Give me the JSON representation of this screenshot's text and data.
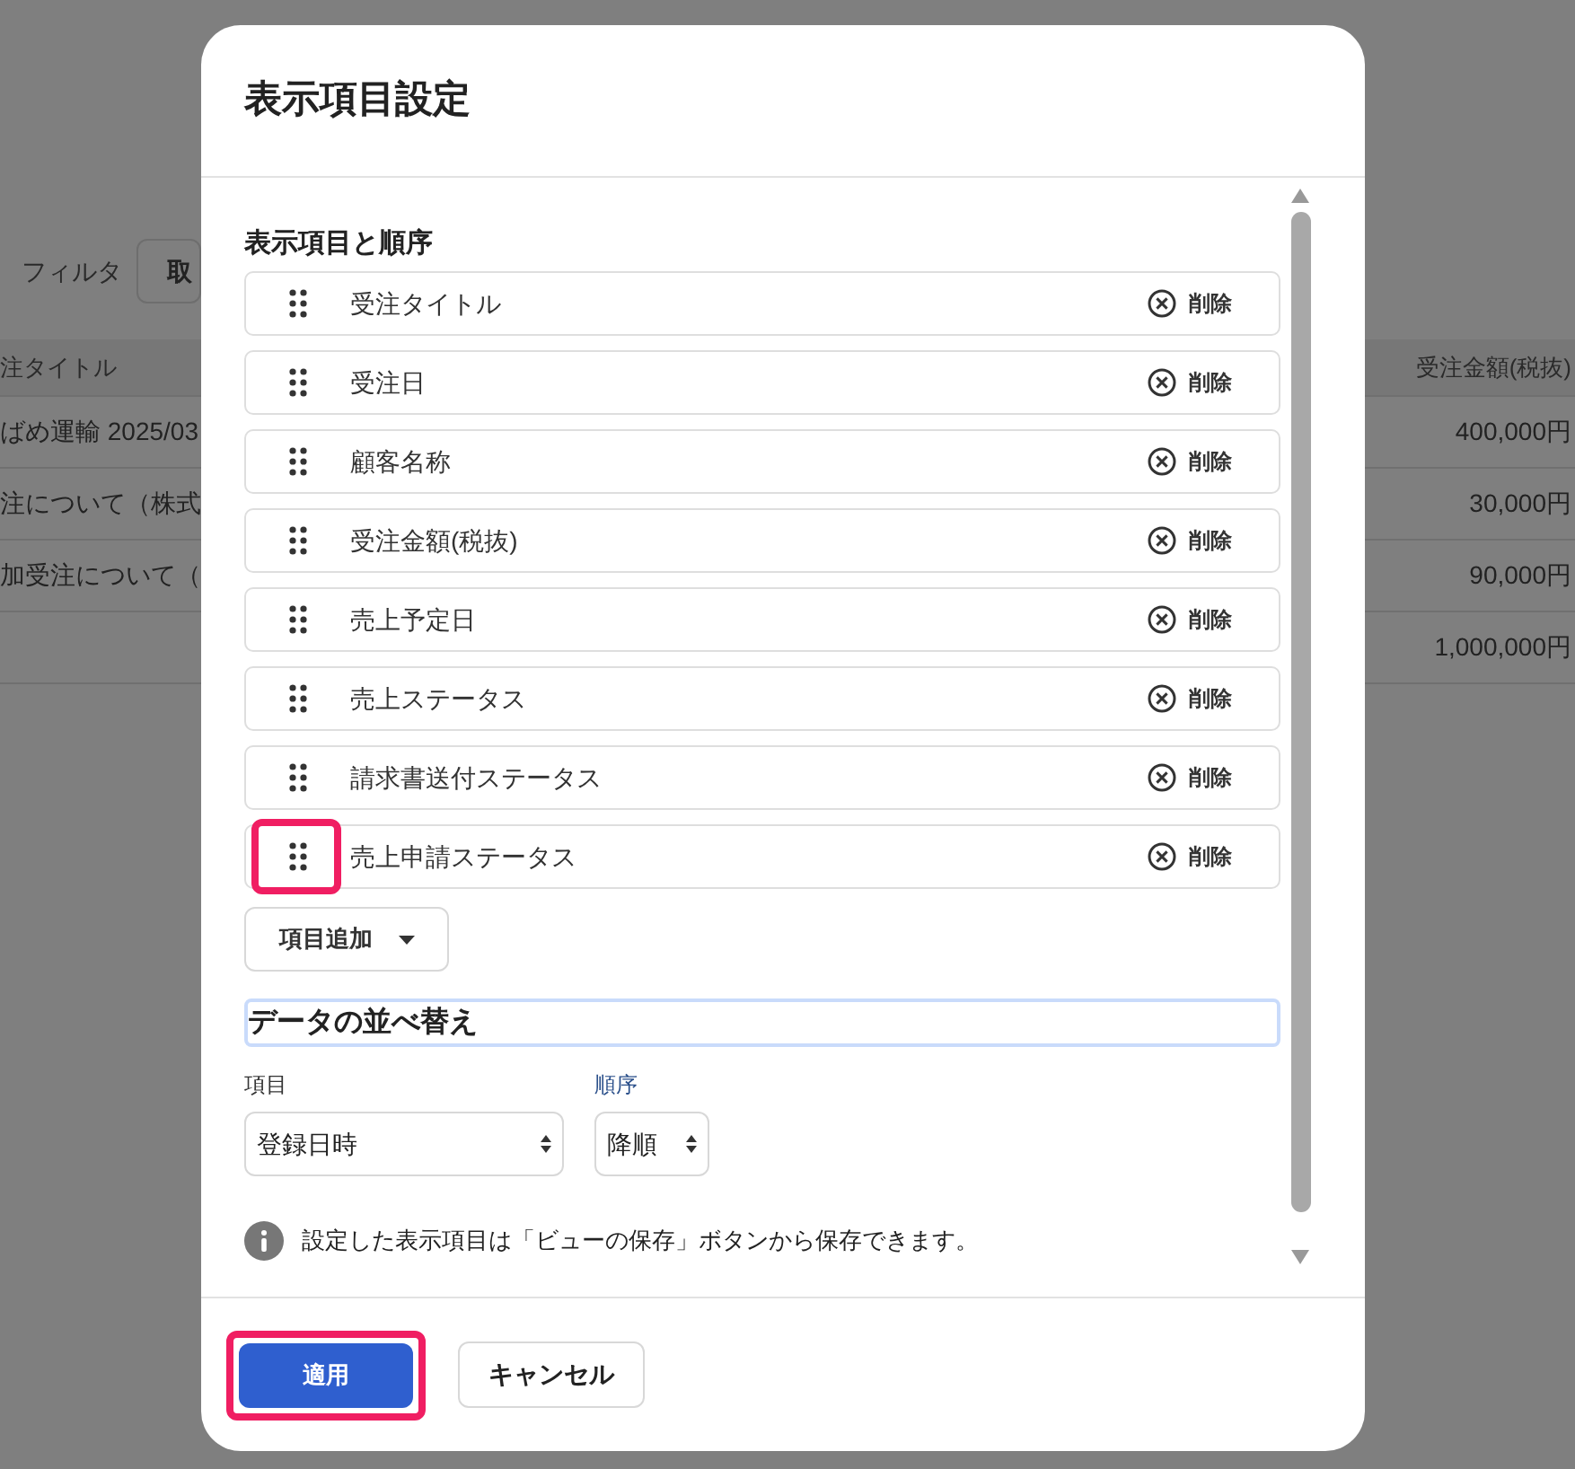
{
  "background": {
    "filter_label": "フィルタ",
    "cancel_button": "取",
    "columns": [
      "注タイトル",
      "受注金額(税抜)"
    ],
    "rows": [
      {
        "title": "ばめ運輸 2025/03",
        "amount": "400,000円"
      },
      {
        "title": "注について（株式",
        "amount": "30,000円"
      },
      {
        "title": "加受注について（",
        "amount": "90,000円"
      },
      {
        "amount": "1,000,000円"
      }
    ]
  },
  "dialog": {
    "title": "表示項目設定",
    "section_title": "表示項目と順序",
    "items": [
      {
        "label": "受注タイトル",
        "remove_label": "削除",
        "highlighted": false
      },
      {
        "label": "受注日",
        "remove_label": "削除",
        "highlighted": false
      },
      {
        "label": "顧客名称",
        "remove_label": "削除",
        "highlighted": false
      },
      {
        "label": "受注金額(税抜)",
        "remove_label": "削除",
        "highlighted": false
      },
      {
        "label": "売上予定日",
        "remove_label": "削除",
        "highlighted": false
      },
      {
        "label": "売上ステータス",
        "remove_label": "削除",
        "highlighted": false
      },
      {
        "label": "請求書送付ステータス",
        "remove_label": "削除",
        "highlighted": false
      },
      {
        "label": "売上申請ステータス",
        "remove_label": "削除",
        "highlighted": true
      }
    ],
    "add_button": "項目追加",
    "sort": {
      "heading": "データの並べ替え",
      "focused": true,
      "fields": [
        {
          "label": "項目",
          "value": "登録日時"
        },
        {
          "label": "順序",
          "value": "降順"
        }
      ]
    },
    "note": "設定した表示項目は「ビューの保存」ボタンから保存できます。",
    "buttons": [
      {
        "label": "適用",
        "kind": "primary",
        "highlighted": true
      },
      {
        "label": "キャンセル",
        "kind": "secondary",
        "highlighted": false
      }
    ]
  }
}
